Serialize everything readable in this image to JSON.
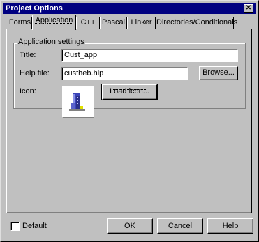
{
  "window": {
    "title": "Project Options",
    "close_glyph": "✕"
  },
  "tabs": [
    {
      "label": "Forms",
      "active": false
    },
    {
      "label": "Application",
      "active": true
    },
    {
      "label": "C++",
      "active": false
    },
    {
      "label": "Pascal",
      "active": false
    },
    {
      "label": "Linker",
      "active": false
    },
    {
      "label": "Directories/Conditionals",
      "active": false
    }
  ],
  "app_settings": {
    "group_label": "Application settings",
    "title_label": "Title:",
    "title_value": "Cust_app",
    "help_label": "Help file:",
    "help_value": "custheb.hlp",
    "browse_label": "Browse...",
    "icon_label": "Icon:",
    "icon_name": "application-icon",
    "load_icon_label": "Load icon..."
  },
  "footer": {
    "default_label": "Default",
    "default_checked": false,
    "ok_label": "OK",
    "cancel_label": "Cancel",
    "help_label": "Help"
  },
  "colors": {
    "title_bar": "#000080",
    "face": "#c0c0c0"
  }
}
